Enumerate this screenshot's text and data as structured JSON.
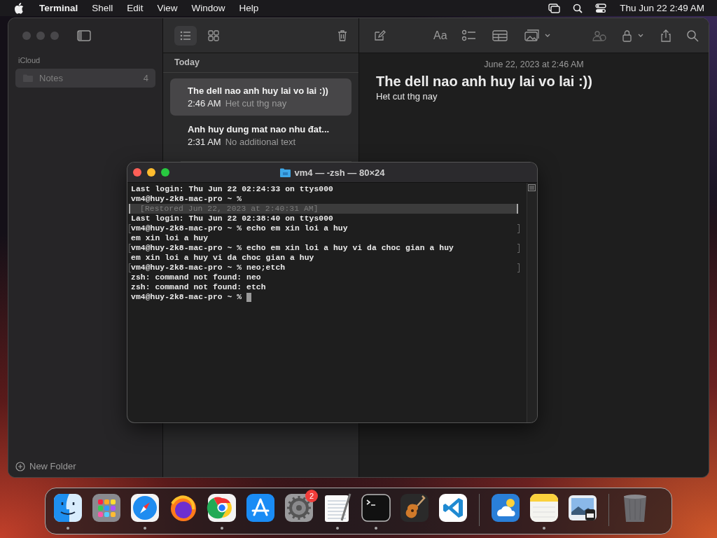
{
  "menu_bar": {
    "app_name": "Terminal",
    "menus": [
      "Shell",
      "Edit",
      "View",
      "Window",
      "Help"
    ],
    "clock": "Thu Jun 22  2:49 AM"
  },
  "notes_window": {
    "sidebar": {
      "section": "iCloud",
      "folders": [
        {
          "name": "Notes",
          "count": "4",
          "selected": true
        }
      ],
      "new_folder": "New Folder"
    },
    "view_buttons": [
      {
        "kind": "list",
        "selected": true
      },
      {
        "kind": "gallery",
        "selected": false
      }
    ],
    "format_label": "Aa",
    "list": {
      "group": "Today",
      "notes": [
        {
          "title": "The dell nao anh huy lai vo lai :))",
          "time": "2:46 AM",
          "preview": "Het cut thg nay",
          "selected": true
        },
        {
          "title": "Anh huy dung mat nao nhu đat...",
          "time": "2:31 AM",
          "preview": "No additional text",
          "selected": false
        }
      ]
    },
    "editor": {
      "date": "June 22, 2023 at 2:46 AM",
      "title": "The dell nao anh huy lai vo lai :))",
      "body": "Het cut thg nay"
    }
  },
  "terminal": {
    "title": "vm4 — -zsh — 80×24",
    "lines": [
      {
        "kind": "output",
        "text": "Last login: Thu Jun 22 02:24:33 on ttys000"
      },
      {
        "kind": "output",
        "text": "vm4@huy-2k8-mac-pro ~ %"
      },
      {
        "kind": "restored",
        "text": "[Restored Jun 22, 2023 at 2:40:31 AM]"
      },
      {
        "kind": "output",
        "text": "Last login: Thu Jun 22 02:38:40 on ttys000"
      },
      {
        "kind": "marked",
        "text": "vm4@huy-2k8-mac-pro ~ % echo em xin loi a huy"
      },
      {
        "kind": "output",
        "text": "em xin loi a huy"
      },
      {
        "kind": "marked",
        "text": "vm4@huy-2k8-mac-pro ~ % echo em xin loi a huy vi da choc gian a huy"
      },
      {
        "kind": "output",
        "text": "em xin loi a huy vi da choc gian a huy"
      },
      {
        "kind": "marked",
        "text": "vm4@huy-2k8-mac-pro ~ % neo;etch"
      },
      {
        "kind": "output",
        "text": "zsh: command not found: neo"
      },
      {
        "kind": "output",
        "text": "zsh: command not found: etch"
      },
      {
        "kind": "current",
        "text": "vm4@huy-2k8-mac-pro ~ %"
      }
    ]
  },
  "dock": {
    "apps": [
      {
        "kind": "finder",
        "running": true
      },
      {
        "kind": "launchpad",
        "running": false
      },
      {
        "kind": "safari",
        "running": true
      },
      {
        "kind": "firefox",
        "running": false
      },
      {
        "kind": "chrome",
        "running": true
      },
      {
        "kind": "appstore",
        "running": false
      },
      {
        "kind": "settings",
        "running": false,
        "badge": "2"
      },
      {
        "kind": "textedit",
        "running": true
      },
      {
        "kind": "terminal",
        "running": true
      },
      {
        "kind": "garageband",
        "running": false
      },
      {
        "kind": "vscode",
        "running": false
      }
    ],
    "recent": [
      {
        "kind": "weather",
        "running": false
      },
      {
        "kind": "notes",
        "running": true
      },
      {
        "kind": "preview",
        "running": false
      }
    ]
  }
}
